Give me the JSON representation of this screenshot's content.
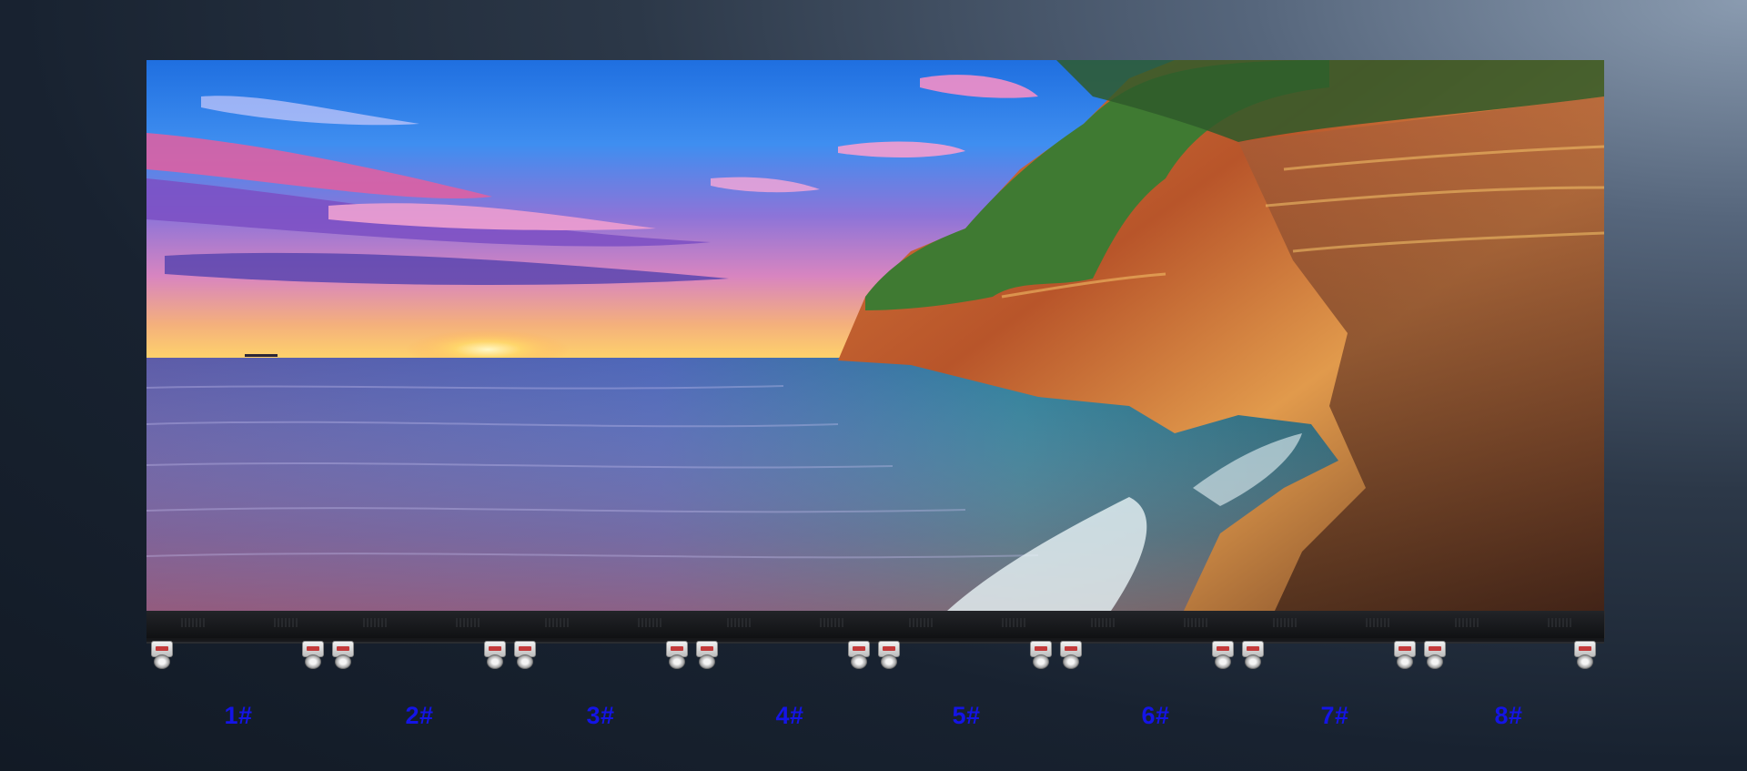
{
  "unit_labels": [
    "1#",
    "2#",
    "3#",
    "4#",
    "5#",
    "6#",
    "7#",
    "8#"
  ],
  "label_color": "#1414e6",
  "screen_content": "sunset-coastal-cliff-landscape"
}
